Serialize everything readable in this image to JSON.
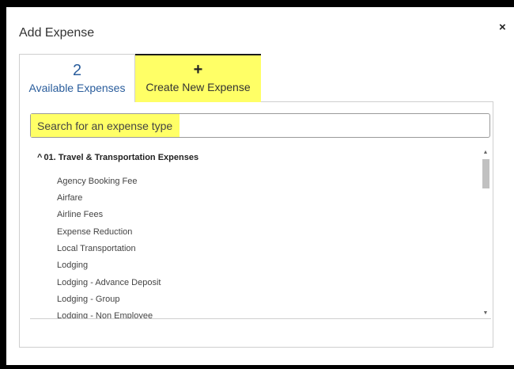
{
  "dialog": {
    "title": "Add Expense",
    "close_symbol": "×"
  },
  "tabs": {
    "available": {
      "count": "2",
      "label": "Available Expenses"
    },
    "create": {
      "symbol": "+",
      "label": "Create New Expense"
    }
  },
  "search": {
    "placeholder": "Search for an expense type",
    "value": ""
  },
  "expense_list": {
    "group": {
      "caret": "^",
      "label": "01. Travel & Transportation Expenses"
    },
    "items": [
      "Agency Booking Fee",
      "Airfare",
      "Airline Fees",
      "Expense Reduction",
      "Local Transportation",
      "Lodging",
      "Lodging - Advance Deposit",
      "Lodging - Group",
      "Lodging - Non Employee"
    ]
  },
  "scrollbar": {
    "up": "▲",
    "down": "▼",
    "position": 0.0
  },
  "colors": {
    "highlight": "#ffff66",
    "link_blue": "#2a5d9c",
    "border": "#cfcfcf"
  },
  "icons": [
    "close-icon",
    "plus-icon",
    "caret-up-icon",
    "scroll-up-arrow-icon",
    "scroll-down-arrow-icon"
  ]
}
